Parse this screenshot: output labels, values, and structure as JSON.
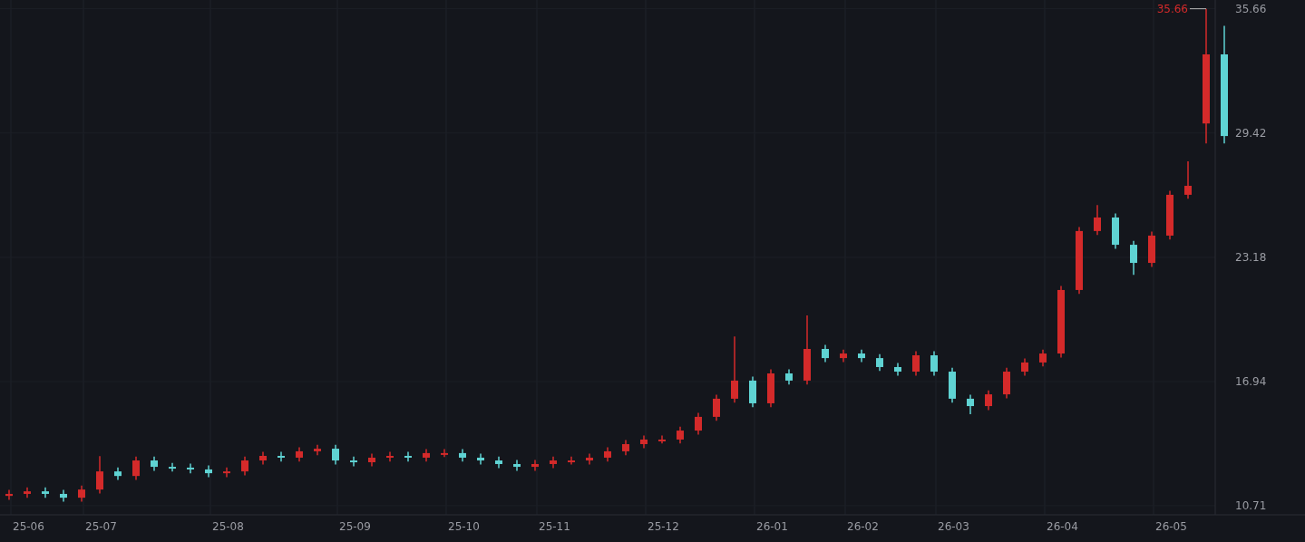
{
  "chart": {
    "chart_data": {
      "type": "candlestick",
      "categories": [
        null,
        "25-06",
        null,
        null,
        null,
        "25-07",
        null,
        null,
        null,
        null,
        null,
        null,
        "25-08",
        null,
        null,
        null,
        null,
        null,
        null,
        "25-09",
        null,
        null,
        null,
        null,
        null,
        "25-10",
        null,
        null,
        null,
        null,
        "25-11",
        null,
        null,
        null,
        null,
        null,
        "25-12",
        null,
        null,
        null,
        null,
        null,
        "26-01",
        null,
        null,
        null,
        null,
        "26-02",
        null,
        null,
        null,
        null,
        "26-03",
        null,
        null,
        null,
        null,
        null,
        "26-04",
        null,
        null,
        null,
        null,
        null,
        "26-05",
        null,
        null,
        null
      ],
      "ohlc": [
        [
          11.2,
          11.5,
          11.0,
          11.3
        ],
        [
          11.3,
          11.63,
          11.1,
          11.43
        ],
        [
          11.43,
          11.63,
          11.1,
          11.3
        ],
        [
          11.3,
          11.5,
          10.91,
          11.11
        ],
        [
          11.11,
          11.72,
          10.91,
          11.52
        ],
        [
          11.52,
          13.2,
          11.32,
          12.43
        ],
        [
          12.43,
          12.63,
          12.0,
          12.2
        ],
        [
          12.2,
          13.18,
          12.0,
          12.98
        ],
        [
          12.98,
          13.18,
          12.46,
          12.66
        ],
        [
          12.66,
          12.86,
          12.42,
          12.62
        ],
        [
          12.62,
          12.82,
          12.33,
          12.53
        ],
        [
          12.53,
          12.73,
          12.14,
          12.34
        ],
        [
          12.34,
          12.63,
          12.14,
          12.43
        ],
        [
          12.43,
          13.18,
          12.23,
          12.98
        ],
        [
          12.98,
          13.41,
          12.78,
          13.21
        ],
        [
          13.21,
          13.41,
          12.92,
          13.12
        ],
        [
          13.12,
          13.64,
          12.92,
          13.44
        ],
        [
          13.44,
          13.77,
          13.24,
          13.57
        ],
        [
          13.57,
          13.77,
          12.78,
          12.98
        ],
        [
          12.98,
          13.18,
          12.69,
          12.89
        ],
        [
          12.89,
          13.32,
          12.69,
          13.12
        ],
        [
          13.12,
          13.41,
          12.92,
          13.21
        ],
        [
          13.21,
          13.41,
          12.92,
          13.12
        ],
        [
          13.12,
          13.55,
          12.92,
          13.35
        ],
        [
          13.35,
          13.55,
          13.15,
          13.35
        ],
        [
          13.35,
          13.55,
          12.92,
          13.12
        ],
        [
          13.12,
          13.32,
          12.78,
          12.98
        ],
        [
          12.98,
          13.18,
          12.6,
          12.8
        ],
        [
          12.8,
          13.0,
          12.46,
          12.66
        ],
        [
          12.66,
          13.0,
          12.46,
          12.8
        ],
        [
          12.8,
          13.18,
          12.6,
          12.98
        ],
        [
          12.98,
          13.18,
          12.78,
          12.98
        ],
        [
          12.98,
          13.32,
          12.78,
          13.12
        ],
        [
          13.12,
          13.64,
          12.92,
          13.44
        ],
        [
          13.44,
          14.0,
          13.24,
          13.8
        ],
        [
          13.8,
          14.23,
          13.6,
          14.03
        ],
        [
          14.03,
          14.23,
          13.83,
          14.03
        ],
        [
          14.03,
          14.68,
          13.83,
          14.48
        ],
        [
          14.48,
          15.37,
          14.28,
          15.17
        ],
        [
          15.17,
          16.28,
          14.97,
          16.08
        ],
        [
          16.08,
          19.2,
          15.88,
          16.99
        ],
        [
          16.99,
          17.19,
          15.65,
          15.85
        ],
        [
          15.85,
          17.55,
          15.65,
          17.35
        ],
        [
          17.35,
          17.55,
          16.79,
          16.99
        ],
        [
          16.99,
          20.26,
          16.79,
          18.58
        ],
        [
          18.58,
          18.78,
          17.92,
          18.12
        ],
        [
          18.12,
          18.55,
          17.92,
          18.35
        ],
        [
          18.35,
          18.55,
          17.92,
          18.12
        ],
        [
          18.12,
          18.32,
          17.47,
          17.67
        ],
        [
          17.67,
          17.87,
          17.24,
          17.44
        ],
        [
          17.44,
          18.46,
          17.24,
          18.26
        ],
        [
          18.26,
          18.46,
          17.24,
          17.44
        ],
        [
          17.44,
          17.64,
          15.88,
          16.08
        ],
        [
          16.08,
          16.28,
          15.3,
          15.71
        ],
        [
          15.71,
          16.5,
          15.51,
          16.3
        ],
        [
          16.3,
          17.64,
          16.1,
          17.44
        ],
        [
          17.44,
          18.1,
          17.24,
          17.9
        ],
        [
          17.9,
          18.55,
          17.7,
          18.35
        ],
        [
          18.35,
          21.74,
          18.15,
          21.54
        ],
        [
          21.54,
          24.7,
          21.34,
          24.5
        ],
        [
          24.5,
          25.8,
          24.3,
          25.18
        ],
        [
          25.18,
          25.38,
          23.61,
          23.81
        ],
        [
          23.81,
          24.01,
          22.3,
          22.9
        ],
        [
          22.9,
          24.47,
          22.7,
          24.27
        ],
        [
          24.27,
          26.52,
          24.07,
          26.32
        ],
        [
          26.32,
          28.0,
          26.12,
          26.77
        ],
        [
          29.9,
          35.66,
          28.9,
          33.37
        ],
        [
          33.37,
          34.8,
          28.9,
          29.27
        ]
      ],
      "yticks": [
        35.66,
        29.42,
        23.18,
        16.94,
        10.71
      ],
      "ylim": [
        10.16,
        36.1
      ],
      "grid": true,
      "annotations": [
        "35.66"
      ]
    }
  }
}
